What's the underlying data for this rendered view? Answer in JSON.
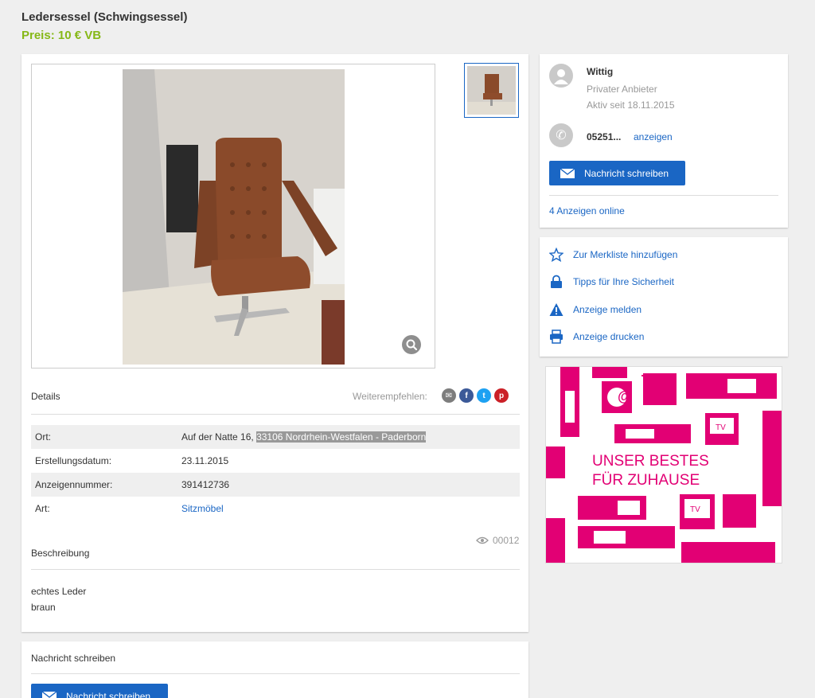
{
  "listing": {
    "title": "Ledersessel (Schwingsessel)",
    "price": "Preis: 10 € VB"
  },
  "details": {
    "label": "Details",
    "share_label": "Weiterempfehlen:",
    "share": [
      {
        "icon": "email-icon",
        "color": "#7d7d7d"
      },
      {
        "icon": "facebook-icon",
        "color": "#3b5998"
      },
      {
        "icon": "twitter-icon",
        "color": "#1da1f2"
      },
      {
        "icon": "pinterest-icon",
        "color": "#cb2027"
      }
    ],
    "rows": [
      {
        "key": "Ort:",
        "value_plain": "Auf der Natte 16,",
        "value_highlight": "33106 Nordrhein-Westfalen - Paderborn"
      },
      {
        "key": "Erstellungsdatum:",
        "value": "23.11.2015"
      },
      {
        "key": "Anzeigennummer:",
        "value": "391412736"
      },
      {
        "key": "Art:",
        "value": "Sitzmöbel"
      }
    ],
    "views": "00012"
  },
  "description": {
    "label": "Beschreibung",
    "line1": "echtes Leder",
    "line2": "braun"
  },
  "message_section": {
    "title": "Nachricht schreiben",
    "button": "Nachricht schreiben"
  },
  "seller": {
    "name": "Wittig",
    "type": "Privater Anbieter",
    "since": "Aktiv seit 18.11.2015",
    "phone": "05251...",
    "phone_reveal": "anzeigen",
    "message_button": "Nachricht schreiben",
    "ads_online": "4 Anzeigen online"
  },
  "actions": [
    {
      "label": "Zur Merkliste hinzufügen",
      "icon": "star-icon"
    },
    {
      "label": "Tipps für Ihre Sicherheit",
      "icon": "lock-icon"
    },
    {
      "label": "Anzeige melden",
      "icon": "warning-icon"
    },
    {
      "label": "Anzeige drucken",
      "icon": "printer-icon"
    }
  ],
  "ad": {
    "line1": "UNSER BESTES",
    "line2": "FÜR ZUHAUSE",
    "tv1": "TV",
    "tv2": "TV",
    "brand_color": "#e20074"
  }
}
